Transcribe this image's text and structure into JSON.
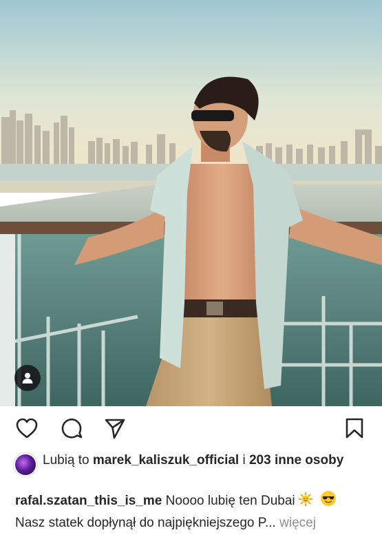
{
  "post": {
    "photo": {
      "description_icon": "tagged-user-icon",
      "colors": {
        "sky_top": "#9fc7d1",
        "sky_bottom": "#f0e7cc",
        "sea": "#b9ccc9",
        "skin": "#d8a07d",
        "shirt": "#cfe0da",
        "pants": "#c8a67a"
      }
    },
    "actions": {
      "like_icon": "heart-icon",
      "comment_icon": "comment-icon",
      "share_icon": "send-icon",
      "save_icon": "bookmark-icon"
    },
    "likes": {
      "prefix": "Lubią to ",
      "user": "marek_kaliszuk_official",
      "middle": " i ",
      "count": "203",
      "suffix": " inne osoby"
    },
    "caption": {
      "username": "rafal.szatan_this_is_me",
      "line1": " Noooo lubię ten Dubai",
      "line2": "Nasz statek dopłynął do najpiękniejszego P",
      "ellipsis": "...",
      "more": " więcej"
    }
  }
}
